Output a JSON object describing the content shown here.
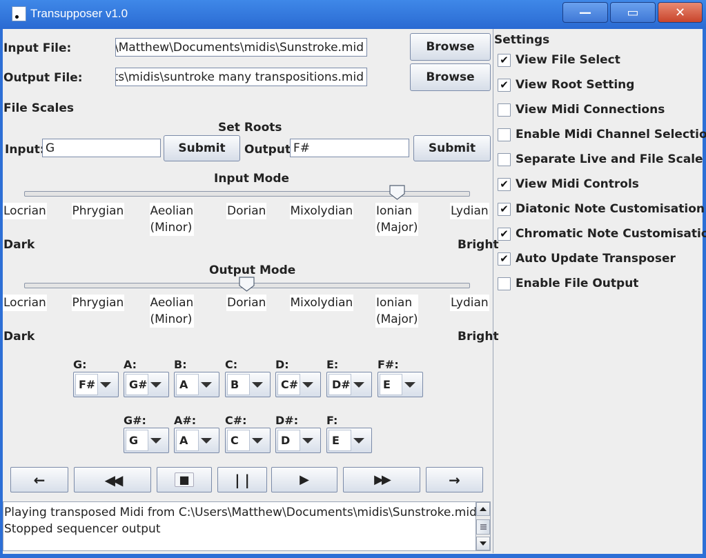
{
  "window": {
    "title": "Transupposer v1.0",
    "minimize": "—",
    "maximize": "▭",
    "close": "✕"
  },
  "files": {
    "input_label": "Input File:",
    "input_value": "C:\\Users\\Matthew\\Documents\\midis\\Sunstroke.mid",
    "output_label": "Output File:",
    "output_value": "C:\\Users\\Matthew\\Documents\\midis\\suntroke many transpositions.mid",
    "browse_label": "Browse"
  },
  "scales": {
    "heading": "File Scales",
    "set_roots": "Set Roots",
    "input_label": "Input:",
    "input_root": "G",
    "output_label": "Output:",
    "output_root": "F#",
    "submit_label": "Submit"
  },
  "input_mode": {
    "title": "Input Mode",
    "selected_index": 5,
    "modes": [
      "Locrian",
      "Phrygian",
      "Aeolian",
      "Dorian",
      "Mixolydian",
      "Ionian",
      "Lydian"
    ],
    "mode_sub": [
      "",
      "",
      "(Minor)",
      "",
      "",
      "(Major)",
      ""
    ],
    "dark": "Dark",
    "bright": "Bright"
  },
  "output_mode": {
    "title": "Output Mode",
    "selected_index": 3,
    "modes": [
      "Locrian",
      "Phrygian",
      "Aeolian",
      "Dorian",
      "Mixolydian",
      "Ionian",
      "Lydian"
    ],
    "mode_sub": [
      "",
      "",
      "(Minor)",
      "",
      "",
      "(Major)",
      ""
    ],
    "dark": "Dark",
    "bright": "Bright"
  },
  "diatonic": [
    {
      "label": "G:",
      "value": "F#"
    },
    {
      "label": "A:",
      "value": "G#"
    },
    {
      "label": "B:",
      "value": "A"
    },
    {
      "label": "C:",
      "value": "B"
    },
    {
      "label": "D:",
      "value": "C#"
    },
    {
      "label": "E:",
      "value": "D#"
    },
    {
      "label": "F#:",
      "value": "E"
    }
  ],
  "chromatic": [
    {
      "label": "G#:",
      "value": "G"
    },
    {
      "label": "A#:",
      "value": "A"
    },
    {
      "label": "C#:",
      "value": "C"
    },
    {
      "label": "D#:",
      "value": "D"
    },
    {
      "label": "F:",
      "value": "E"
    }
  ],
  "transport": {
    "prev": "←",
    "rewind": "◀◀",
    "stop": "■",
    "pause": "| |",
    "play": "▶",
    "forward": "▶▶",
    "next": "→"
  },
  "log": [
    "Playing transposed Midi from C:\\Users\\Matthew\\Documents\\midis\\Sunstroke.mid",
    "Stopped sequencer output"
  ],
  "settings": {
    "heading": "Settings",
    "items": [
      {
        "label": "View File Select",
        "checked": true
      },
      {
        "label": "View Root Setting",
        "checked": true
      },
      {
        "label": "View Midi Connections",
        "checked": false
      },
      {
        "label": "Enable Midi Channel Selection",
        "checked": false
      },
      {
        "label": "Separate Live and File Scale",
        "checked": false
      },
      {
        "label": "View Midi Controls",
        "checked": true
      },
      {
        "label": "Diatonic Note Customisation",
        "checked": true
      },
      {
        "label": "Chromatic Note Customisation",
        "checked": true
      },
      {
        "label": "Auto Update Transposer",
        "checked": true
      },
      {
        "label": "Enable File Output",
        "checked": false
      }
    ],
    "check_mark": "✔"
  }
}
